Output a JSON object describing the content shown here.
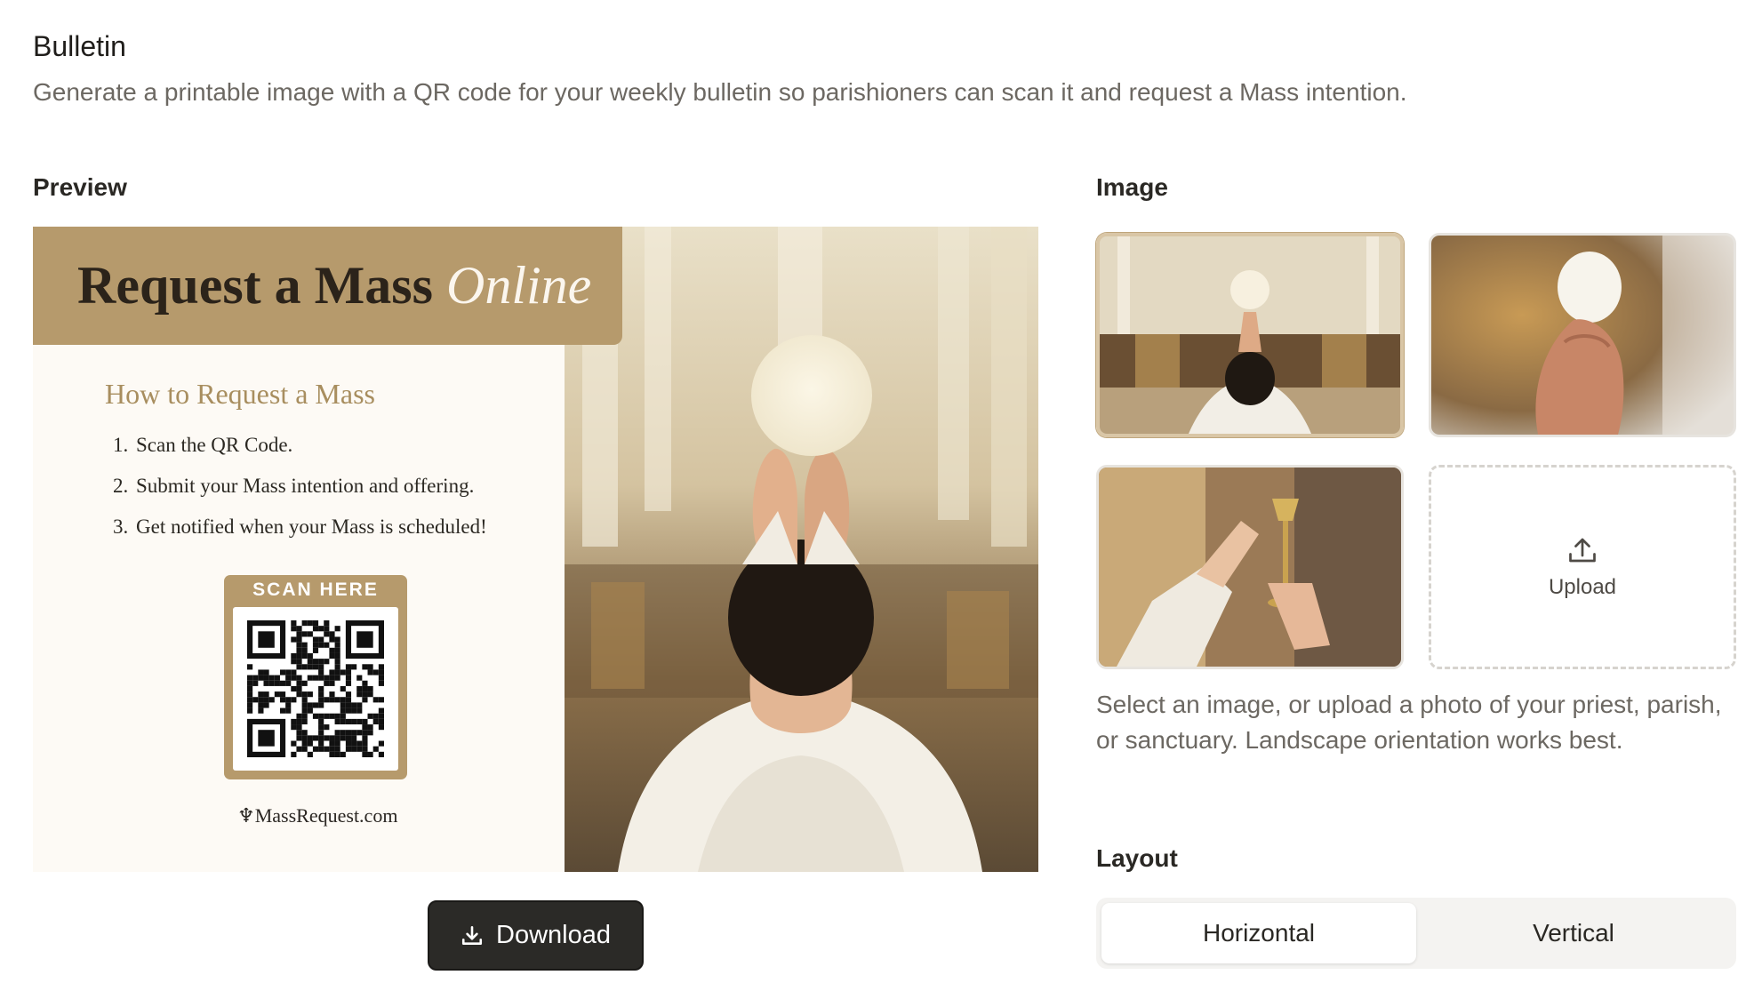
{
  "header": {
    "title": "Bulletin",
    "description": "Generate a printable image with a QR code for your weekly bulletin so parishioners can scan it and request a Mass intention."
  },
  "preview": {
    "label": "Preview",
    "banner_title": "Request a Mass",
    "banner_title_accent": "Online",
    "howto_heading": "How to Request a Mass",
    "steps": [
      {
        "num": "1.",
        "text": "Scan the QR Code."
      },
      {
        "num": "2.",
        "text": "Submit your Mass intention and offering."
      },
      {
        "num": "3.",
        "text": "Get notified when your Mass is scheduled!"
      }
    ],
    "scan_label": "SCAN HERE",
    "brand": "MassRequest.com",
    "download_label": "Download"
  },
  "image": {
    "label": "Image",
    "thumbnails": [
      {
        "name": "priest-elevating-host-altar",
        "selected": true
      },
      {
        "name": "hands-holding-host",
        "selected": false
      },
      {
        "name": "priest-raising-chalice",
        "selected": false
      }
    ],
    "upload_label": "Upload",
    "help_text": "Select an image, or upload a photo of your priest, parish, or sanctuary. Landscape orientation works best."
  },
  "layout": {
    "label": "Layout",
    "options": [
      "Horizontal",
      "Vertical"
    ],
    "selected": "Horizontal"
  },
  "colors": {
    "accent_gold": "#b69a6c",
    "button_dark": "#2b2a27",
    "muted_text": "#6c6862"
  }
}
